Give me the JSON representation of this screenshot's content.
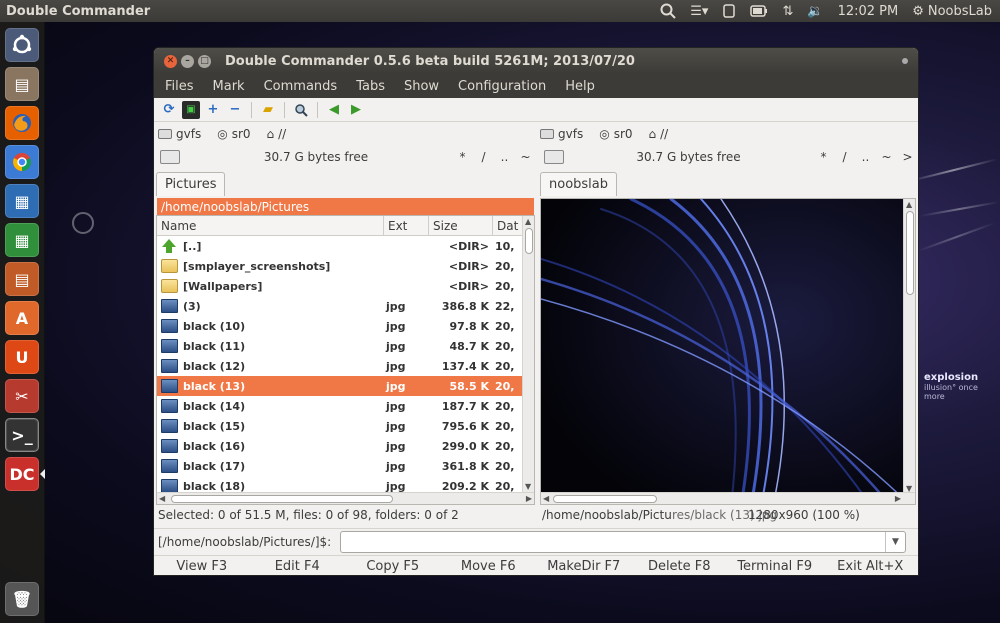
{
  "top_panel": {
    "app_title": "Double Commander",
    "clock": "12:02 PM",
    "user": "NoobsLab"
  },
  "desktop": {
    "text_big": "explosion",
    "text_small": "illusion° once more"
  },
  "window": {
    "title": "Double Commander 0.5.6 beta build 5261M; 2013/07/20",
    "menu": [
      "Files",
      "Mark",
      "Commands",
      "Tabs",
      "Show",
      "Configuration",
      "Help"
    ]
  },
  "left": {
    "drives": [
      "gvfs",
      "sr0",
      "//"
    ],
    "free_space": "30.7 G bytes free",
    "nav": [
      "*",
      "/",
      "..",
      "~"
    ],
    "tab": "Pictures",
    "path": "/home/noobslab/Pictures",
    "columns": [
      "Name",
      "Ext",
      "Size",
      "Dat"
    ],
    "rows": [
      {
        "icon": "up",
        "name": "[..]",
        "ext": "",
        "size": "<DIR>",
        "date": "10,"
      },
      {
        "icon": "folder",
        "name": "[smplayer_screenshots]",
        "ext": "",
        "size": "<DIR>",
        "date": "20,"
      },
      {
        "icon": "folder",
        "name": "[Wallpapers]",
        "ext": "",
        "size": "<DIR>",
        "date": "20,"
      },
      {
        "icon": "img",
        "name": "(3)",
        "ext": "jpg",
        "size": "386.8 K",
        "date": "22,"
      },
      {
        "icon": "img",
        "name": "black (10)",
        "ext": "jpg",
        "size": "97.8 K",
        "date": "20,"
      },
      {
        "icon": "img",
        "name": "black (11)",
        "ext": "jpg",
        "size": "48.7 K",
        "date": "20,"
      },
      {
        "icon": "img",
        "name": "black (12)",
        "ext": "jpg",
        "size": "137.4 K",
        "date": "20,"
      },
      {
        "icon": "img",
        "name": "black (13)",
        "ext": "jpg",
        "size": "58.5 K",
        "date": "20,"
      },
      {
        "icon": "img",
        "name": "black (14)",
        "ext": "jpg",
        "size": "187.7 K",
        "date": "20,"
      },
      {
        "icon": "img",
        "name": "black (15)",
        "ext": "jpg",
        "size": "795.6 K",
        "date": "20,"
      },
      {
        "icon": "img",
        "name": "black (16)",
        "ext": "jpg",
        "size": "299.0 K",
        "date": "20,"
      },
      {
        "icon": "img",
        "name": "black (17)",
        "ext": "jpg",
        "size": "361.8 K",
        "date": "20,"
      },
      {
        "icon": "img",
        "name": "black (18)",
        "ext": "jpg",
        "size": "209.2 K",
        "date": "20,"
      }
    ],
    "selected_index": 7,
    "status": "Selected: 0 of 51.5 M, files: 0 of 98, folders: 0 of 2"
  },
  "right": {
    "drives": [
      "gvfs",
      "sr0",
      "//"
    ],
    "free_space": "30.7 G bytes free",
    "nav": [
      "*",
      "/",
      "..",
      "~",
      ">"
    ],
    "tab": "noobslab",
    "status": "/home/noobslab/Pictu",
    "status_overlap": "res/black (13).jpg",
    "status_size": "1280x960 (100 %)"
  },
  "cmdline": {
    "label": "[/home/noobslab/Pictures/]$:",
    "value": ""
  },
  "fkeys": [
    "View F3",
    "Edit F4",
    "Copy F5",
    "Move F6",
    "MakeDir F7",
    "Delete F8",
    "Terminal F9",
    "Exit Alt+X"
  ],
  "colors": {
    "accent": "#f07746",
    "titlebar": "#3c3b37",
    "launcher_ff": "#e66000"
  }
}
